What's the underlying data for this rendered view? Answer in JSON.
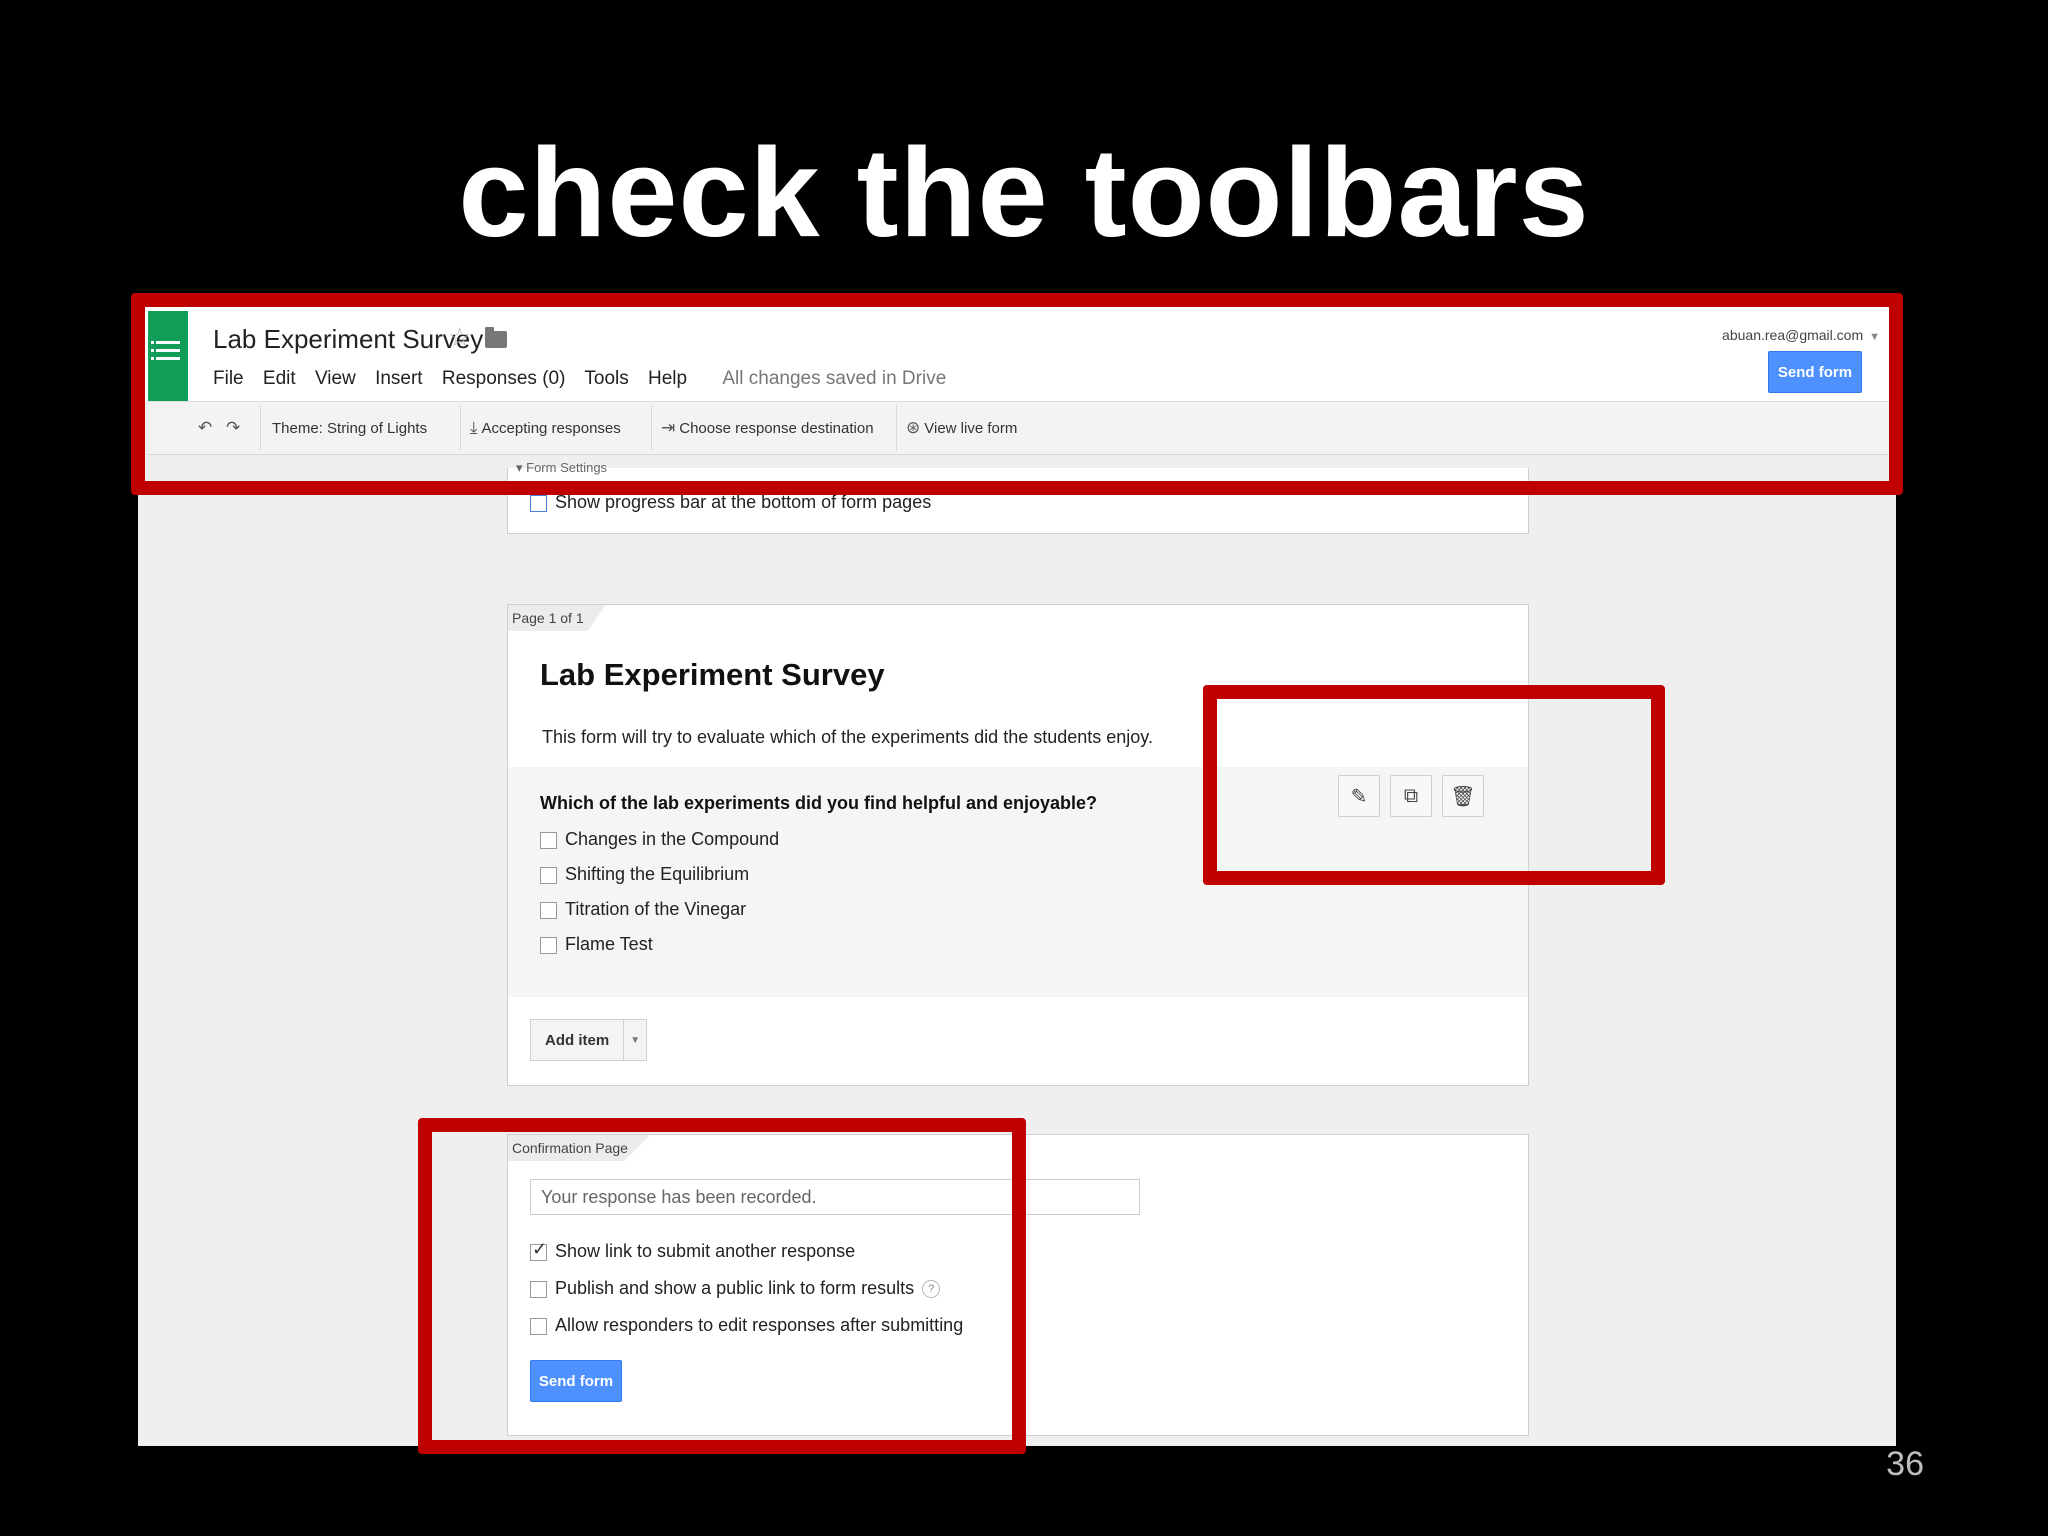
{
  "slide": {
    "title": "check the toolbars",
    "page_number": "36"
  },
  "app": {
    "doc_title": "Lab Experiment Survey",
    "account": "abuan.rea@gmail.com",
    "send_form": "Send form",
    "menu": [
      "File",
      "Edit",
      "View",
      "Insert",
      "Responses (0)",
      "Tools",
      "Help"
    ],
    "save_status": "All changes saved in Drive"
  },
  "toolbar": {
    "theme": "Theme: String of Lights",
    "accepting": "Accepting responses",
    "destination": "Choose response destination",
    "live": "View live form"
  },
  "settings": {
    "label": "Form Settings",
    "progress_bar": "Show progress bar at the bottom of form pages"
  },
  "page": {
    "tag": "Page 1 of 1",
    "title": "Lab Experiment Survey",
    "description": "This form will try to evaluate which of the experiments did the students enjoy.",
    "question": "Which of the lab experiments did you find helpful and enjoyable?",
    "options": [
      "Changes in the Compound",
      "Shifting the Equilibrium",
      "Titration of the Vinegar",
      "Flame Test"
    ],
    "add_item": "Add item"
  },
  "confirmation": {
    "tag": "Confirmation Page",
    "message": "Your response has been recorded.",
    "show_link": "Show link to submit another response",
    "publish": "Publish and show a public link to form results",
    "help": "?",
    "allow_edit": "Allow responders to edit responses after submitting",
    "send_form": "Send form"
  },
  "colors": {
    "highlight": "#c00000",
    "accent": "#4d90fe",
    "logo": "#0f9d58"
  }
}
